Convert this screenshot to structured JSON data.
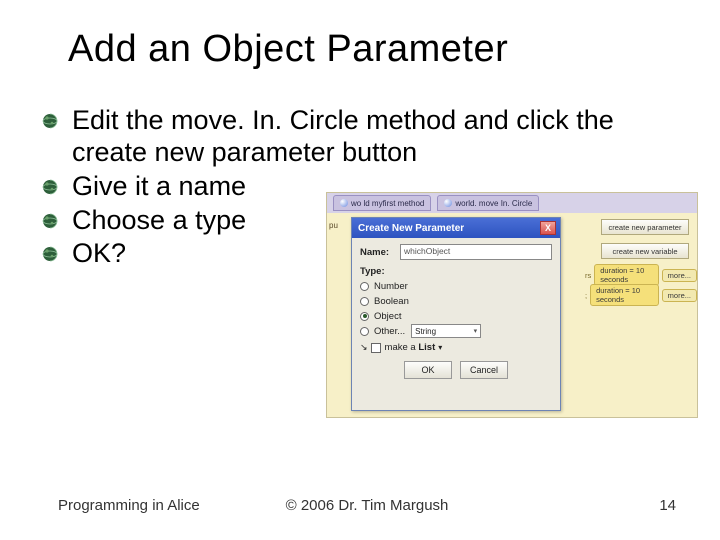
{
  "title": "Add an Object Parameter",
  "bullets": [
    "Edit the move. In. Circle method and click the create new parameter button",
    "Give it a name",
    "Choose a type",
    "OK?"
  ],
  "screenshot": {
    "tabs": [
      "wo ld myfirst method",
      "world. move In. Circle"
    ],
    "left_strip": "pu",
    "right_buttons": [
      "create new parameter",
      "create new variable"
    ],
    "tag_rows": [
      {
        "colon": "rs",
        "tags": [
          "duration = 10 seconds",
          "more..."
        ]
      },
      {
        "colon": ";",
        "tags": [
          "duration = 10 seconds",
          "more..."
        ]
      }
    ],
    "dialog": {
      "title": "Create New Parameter",
      "close": "X",
      "name_label": "Name:",
      "name_value": "whichObject",
      "type_label": "Type:",
      "options": [
        "Number",
        "Boolean",
        "Object",
        "Other..."
      ],
      "selected_index": 2,
      "other_select": "String",
      "list_arrow": "↘",
      "list_check_label": "make a",
      "list_word": "List",
      "ok": "OK",
      "cancel": "Cancel"
    }
  },
  "footer": {
    "left": "Programming in Alice",
    "center": "© 2006 Dr. Tim Margush",
    "right": "14"
  }
}
